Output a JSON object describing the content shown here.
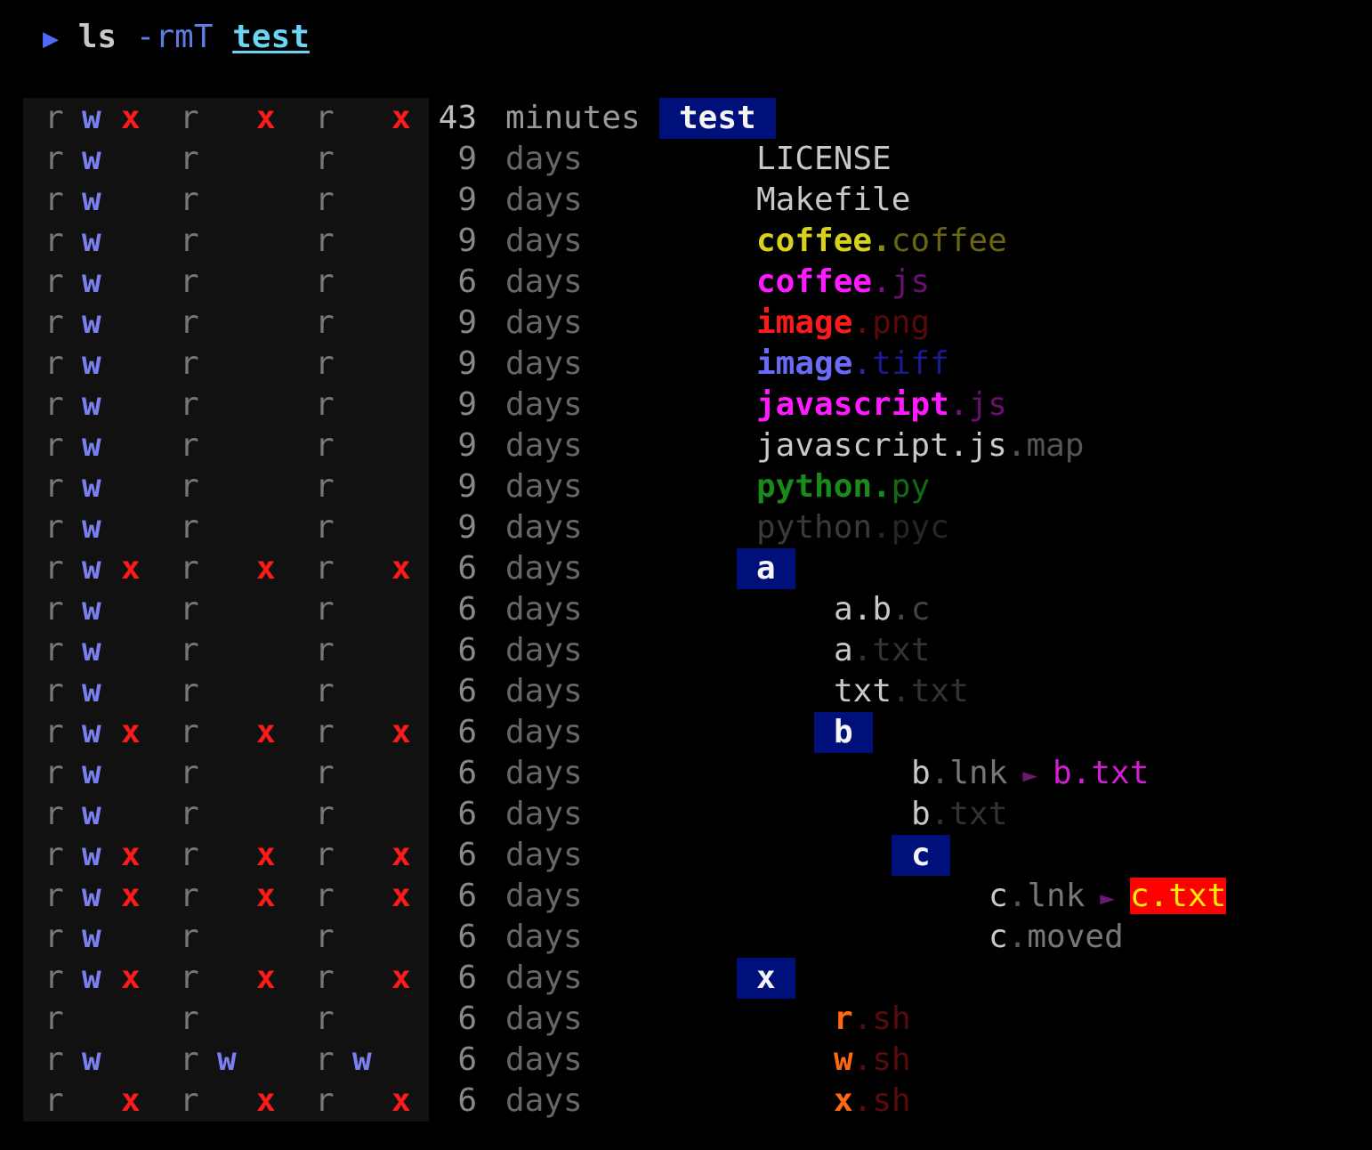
{
  "command": {
    "arrow": "▶",
    "cmd": "ls",
    "flags": "-rmT",
    "path": "test"
  },
  "rows": [
    {
      "perm": [
        "r",
        "w",
        "x",
        "r",
        "",
        "x",
        "r",
        "",
        "x"
      ],
      "num": "43",
      "unit": "minutes",
      "depth": 0,
      "dir": true,
      "parts": [
        {
          "text": "test"
        }
      ]
    },
    {
      "perm": [
        "r",
        "w",
        "",
        "r",
        "",
        "",
        "r",
        "",
        ""
      ],
      "num": "9",
      "unit": "days",
      "depth": 1,
      "parts": [
        {
          "text": "LICENSE",
          "color": "#c8c8c8"
        }
      ]
    },
    {
      "perm": [
        "r",
        "w",
        "",
        "r",
        "",
        "",
        "r",
        "",
        ""
      ],
      "num": "9",
      "unit": "days",
      "depth": 1,
      "parts": [
        {
          "text": "Makefile",
          "color": "#c8c8c8"
        }
      ]
    },
    {
      "perm": [
        "r",
        "w",
        "",
        "r",
        "",
        "",
        "r",
        "",
        ""
      ],
      "num": "9",
      "unit": "days",
      "depth": 1,
      "parts": [
        {
          "text": "coffee",
          "color": "#d6d21a",
          "bold": true
        },
        {
          "text": ".",
          "color": "#8c8a12",
          "bold": true
        },
        {
          "text": "coffee",
          "color": "#6a6610"
        }
      ]
    },
    {
      "perm": [
        "r",
        "w",
        "",
        "r",
        "",
        "",
        "r",
        "",
        ""
      ],
      "num": "6",
      "unit": "days",
      "depth": 1,
      "parts": [
        {
          "text": "coffee",
          "color": "#ff1aff",
          "bold": true
        },
        {
          "text": ".",
          "color": "#7a1080"
        },
        {
          "text": "js",
          "color": "#6a0f70"
        }
      ]
    },
    {
      "perm": [
        "r",
        "w",
        "",
        "r",
        "",
        "",
        "r",
        "",
        ""
      ],
      "num": "9",
      "unit": "days",
      "depth": 1,
      "parts": [
        {
          "text": "image",
          "color": "#ff1a1a",
          "bold": true
        },
        {
          "text": ".",
          "color": "#6a0a0a"
        },
        {
          "text": "png",
          "color": "#5a0808"
        }
      ]
    },
    {
      "perm": [
        "r",
        "w",
        "",
        "r",
        "",
        "",
        "r",
        "",
        ""
      ],
      "num": "9",
      "unit": "days",
      "depth": 1,
      "parts": [
        {
          "text": "image",
          "color": "#6a6cf8",
          "bold": true
        },
        {
          "text": ".",
          "color": "#2a2aa0"
        },
        {
          "text": "tiff",
          "color": "#1a1a90"
        }
      ]
    },
    {
      "perm": [
        "r",
        "w",
        "",
        "r",
        "",
        "",
        "r",
        "",
        ""
      ],
      "num": "9",
      "unit": "days",
      "depth": 1,
      "parts": [
        {
          "text": "javascript",
          "color": "#ff1aff",
          "bold": true
        },
        {
          "text": ".",
          "color": "#7a1080"
        },
        {
          "text": "js",
          "color": "#6a0f70"
        }
      ]
    },
    {
      "perm": [
        "r",
        "w",
        "",
        "r",
        "",
        "",
        "r",
        "",
        ""
      ],
      "num": "9",
      "unit": "days",
      "depth": 1,
      "parts": [
        {
          "text": "javascript.js",
          "color": "#c8c8c8"
        },
        {
          "text": ".",
          "color": "#555"
        },
        {
          "text": "map",
          "color": "#555"
        }
      ]
    },
    {
      "perm": [
        "r",
        "w",
        "",
        "r",
        "",
        "",
        "r",
        "",
        ""
      ],
      "num": "9",
      "unit": "days",
      "depth": 1,
      "parts": [
        {
          "text": "python",
          "color": "#1a8a1a",
          "bold": true
        },
        {
          "text": ".",
          "color": "#1a8a1a",
          "bold": true
        },
        {
          "text": "py",
          "color": "#146a14"
        }
      ]
    },
    {
      "perm": [
        "r",
        "w",
        "",
        "r",
        "",
        "",
        "r",
        "",
        ""
      ],
      "num": "9",
      "unit": "days",
      "depth": 1,
      "parts": [
        {
          "text": "python",
          "color": "#3a3a3a"
        },
        {
          "text": ".",
          "color": "#262626"
        },
        {
          "text": "pyc",
          "color": "#262626"
        }
      ]
    },
    {
      "perm": [
        "r",
        "w",
        "x",
        "r",
        "",
        "x",
        "r",
        "",
        "x"
      ],
      "num": "6",
      "unit": "days",
      "depth": 1,
      "dir": true,
      "parts": [
        {
          "text": "a"
        }
      ]
    },
    {
      "perm": [
        "r",
        "w",
        "",
        "r",
        "",
        "",
        "r",
        "",
        ""
      ],
      "num": "6",
      "unit": "days",
      "depth": 2,
      "parts": [
        {
          "text": "a.b",
          "color": "#c8c8c8"
        },
        {
          "text": ".",
          "color": "#444"
        },
        {
          "text": "c",
          "color": "#444"
        }
      ]
    },
    {
      "perm": [
        "r",
        "w",
        "",
        "r",
        "",
        "",
        "r",
        "",
        ""
      ],
      "num": "6",
      "unit": "days",
      "depth": 2,
      "parts": [
        {
          "text": "a",
          "color": "#c8c8c8"
        },
        {
          "text": ".",
          "color": "#333"
        },
        {
          "text": "txt",
          "color": "#333"
        }
      ]
    },
    {
      "perm": [
        "r",
        "w",
        "",
        "r",
        "",
        "",
        "r",
        "",
        ""
      ],
      "num": "6",
      "unit": "days",
      "depth": 2,
      "parts": [
        {
          "text": "txt",
          "color": "#c8c8c8"
        },
        {
          "text": ".",
          "color": "#333"
        },
        {
          "text": "txt",
          "color": "#333"
        }
      ]
    },
    {
      "perm": [
        "r",
        "w",
        "x",
        "r",
        "",
        "x",
        "r",
        "",
        "x"
      ],
      "num": "6",
      "unit": "days",
      "depth": 2,
      "dir": true,
      "parts": [
        {
          "text": "b"
        }
      ]
    },
    {
      "perm": [
        "r",
        "w",
        "",
        "r",
        "",
        "",
        "r",
        "",
        ""
      ],
      "num": "6",
      "unit": "days",
      "depth": 3,
      "parts": [
        {
          "text": "b",
          "color": "#c8c8c8"
        },
        {
          "text": ".",
          "color": "#555"
        },
        {
          "text": "lnk",
          "color": "#777"
        },
        {
          "text": " ► ",
          "color": "#6a1a70"
        },
        {
          "text": "b",
          "color": "#d020d0"
        },
        {
          "text": ".",
          "color": "#d020d0"
        },
        {
          "text": "txt",
          "color": "#d020d0"
        }
      ]
    },
    {
      "perm": [
        "r",
        "w",
        "",
        "r",
        "",
        "",
        "r",
        "",
        ""
      ],
      "num": "6",
      "unit": "days",
      "depth": 3,
      "parts": [
        {
          "text": "b",
          "color": "#c8c8c8"
        },
        {
          "text": ".",
          "color": "#333"
        },
        {
          "text": "txt",
          "color": "#333"
        }
      ]
    },
    {
      "perm": [
        "r",
        "w",
        "x",
        "r",
        "",
        "x",
        "r",
        "",
        "x"
      ],
      "num": "6",
      "unit": "days",
      "depth": 3,
      "dir": true,
      "parts": [
        {
          "text": "c"
        }
      ]
    },
    {
      "perm": [
        "r",
        "w",
        "x",
        "r",
        "",
        "x",
        "r",
        "",
        "x"
      ],
      "num": "6",
      "unit": "days",
      "depth": 4,
      "parts": [
        {
          "text": "c",
          "color": "#c8c8c8"
        },
        {
          "text": ".",
          "color": "#555"
        },
        {
          "text": "lnk",
          "color": "#777"
        },
        {
          "text": " ► ",
          "color": "#6a1a70"
        },
        {
          "text": "c.txt",
          "color": "#ffee00",
          "bg": "#ff0000"
        }
      ]
    },
    {
      "perm": [
        "r",
        "w",
        "",
        "r",
        "",
        "",
        "r",
        "",
        ""
      ],
      "num": "6",
      "unit": "days",
      "depth": 4,
      "parts": [
        {
          "text": "c",
          "color": "#c8c8c8"
        },
        {
          "text": ".",
          "color": "#555"
        },
        {
          "text": "moved",
          "color": "#777"
        }
      ]
    },
    {
      "perm": [
        "r",
        "w",
        "x",
        "r",
        "",
        "x",
        "r",
        "",
        "x"
      ],
      "num": "6",
      "unit": "days",
      "depth": 1,
      "dir": true,
      "parts": [
        {
          "text": "x"
        }
      ]
    },
    {
      "perm": [
        "r",
        "",
        "",
        "r",
        "",
        "",
        "r",
        "",
        ""
      ],
      "num": "6",
      "unit": "days",
      "depth": 2,
      "parts": [
        {
          "text": "r",
          "color": "#ff6a10",
          "bold": true
        },
        {
          "text": ".",
          "color": "#5a0a0a"
        },
        {
          "text": "sh",
          "color": "#5a0a0a"
        }
      ]
    },
    {
      "perm": [
        "r",
        "w",
        "",
        "r",
        "w",
        "",
        "r",
        "w",
        ""
      ],
      "num": "6",
      "unit": "days",
      "depth": 2,
      "parts": [
        {
          "text": "w",
          "color": "#ff6a10",
          "bold": true
        },
        {
          "text": ".",
          "color": "#5a0a0a"
        },
        {
          "text": "sh",
          "color": "#5a0a0a"
        }
      ]
    },
    {
      "perm": [
        "r",
        "",
        "x",
        "r",
        "",
        "x",
        "r",
        "",
        "x"
      ],
      "num": "6",
      "unit": "days",
      "depth": 2,
      "parts": [
        {
          "text": "x",
          "color": "#ff6a10",
          "bold": true
        },
        {
          "text": ".",
          "color": "#5a0a0a"
        },
        {
          "text": "sh",
          "color": "#5a0a0a"
        }
      ]
    }
  ]
}
